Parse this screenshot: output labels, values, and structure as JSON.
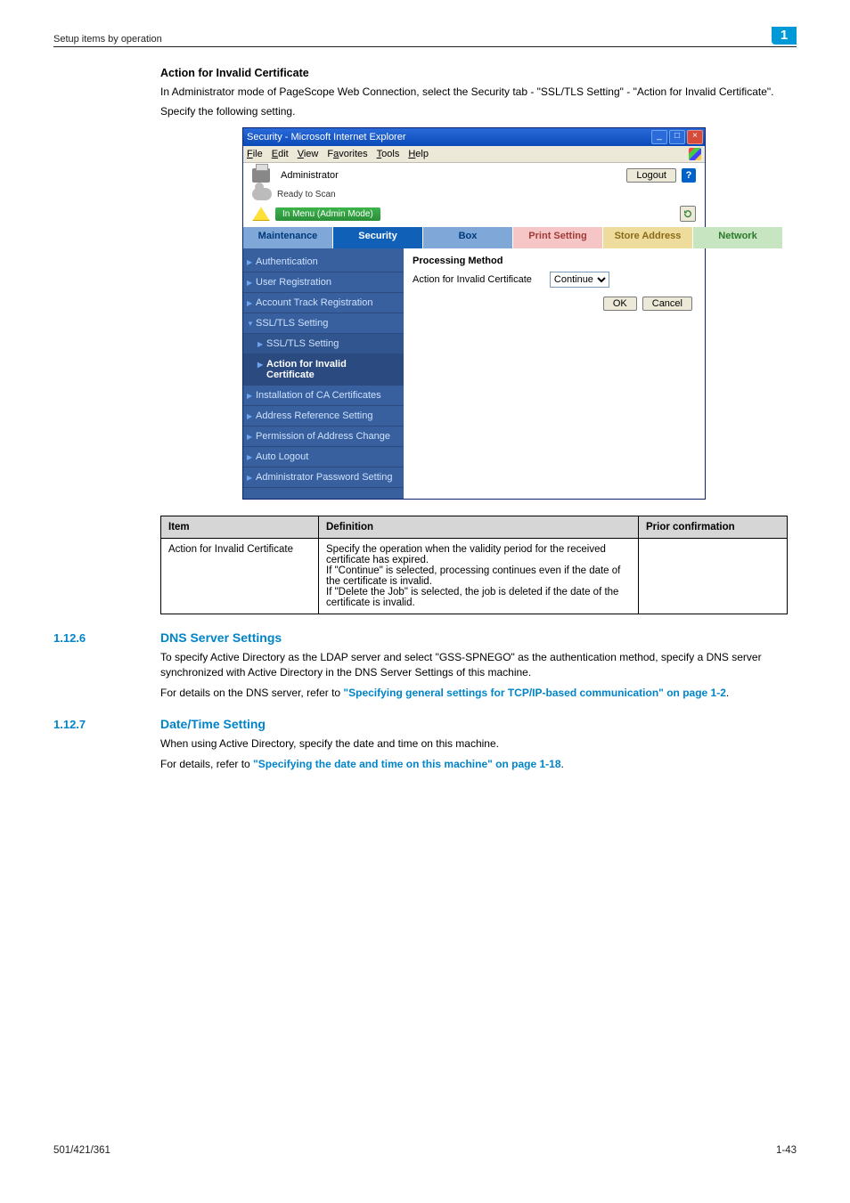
{
  "header": {
    "breadcrumb": "Setup items by operation",
    "chapter": "1"
  },
  "section_action": {
    "heading": "Action for Invalid Certificate",
    "p1": "In Administrator mode of PageScope Web Connection, select the Security tab - \"SSL/TLS Setting\" - \"Action for Invalid Certificate\".",
    "p2": "Specify the following setting."
  },
  "screenshot": {
    "window_title": "Security - Microsoft Internet Explorer",
    "menus": {
      "file": "File",
      "edit": "Edit",
      "view": "View",
      "favorites": "Favorites",
      "tools": "Tools",
      "help": "Help"
    },
    "top": {
      "admin_label": "Administrator",
      "logout_label": "Logout",
      "status_label": "Ready to Scan",
      "mode_label": "In Menu (Admin Mode)"
    },
    "tabs": {
      "maintenance": "Maintenance",
      "security": "Security",
      "box": "Box",
      "print": "Print Setting",
      "store": "Store Address",
      "network": "Network"
    },
    "sidenav": {
      "auth": "Authentication",
      "userreg": "User Registration",
      "accttrack": "Account Track Registration",
      "ssl": "SSL/TLS Setting",
      "ssl_sub": "SSL/TLS Setting",
      "action_cert": "Action for Invalid Certificate",
      "install_ca": "Installation of CA Certificates",
      "addr_ref": "Address Reference Setting",
      "perm_addr": "Permission of Address Change",
      "auto_logout": "Auto Logout",
      "admin_pwd": "Administrator Password Setting"
    },
    "main": {
      "heading": "Processing Method",
      "field_label": "Action for Invalid Certificate",
      "field_value": "Continue",
      "ok": "OK",
      "cancel": "Cancel"
    }
  },
  "def_table": {
    "h_item": "Item",
    "h_def": "Definition",
    "h_prior": "Prior confirmation",
    "r1_item": "Action for Invalid Certificate",
    "r1_def": "Specify the operation when the validity period for the received certificate has expired.\nIf \"Continue\" is selected, processing continues even if the date of the certificate is invalid.\nIf \"Delete the Job\" is selected, the job is deleted if the date of the certificate is invalid.",
    "r1_prior": ""
  },
  "sec_dns": {
    "num": "1.12.6",
    "title": "DNS Server Settings",
    "p1": "To specify Active Directory as the LDAP server and select \"GSS-SPNEGO\" as the authentication method, specify a DNS server synchronized with Active Directory in the DNS Server Settings of this machine.",
    "p2_pre": "For details on the DNS server, refer to ",
    "p2_link": "\"Specifying general settings for TCP/IP-based communication\" on page 1-2",
    "p2_post": "."
  },
  "sec_dt": {
    "num": "1.12.7",
    "title": "Date/Time Setting",
    "p1": "When using Active Directory, specify the date and time on this machine.",
    "p2_pre": "For details, refer to ",
    "p2_link": "\"Specifying the date and time on this machine\" on page 1-18",
    "p2_post": "."
  },
  "footer": {
    "left": "501/421/361",
    "right": "1-43"
  }
}
